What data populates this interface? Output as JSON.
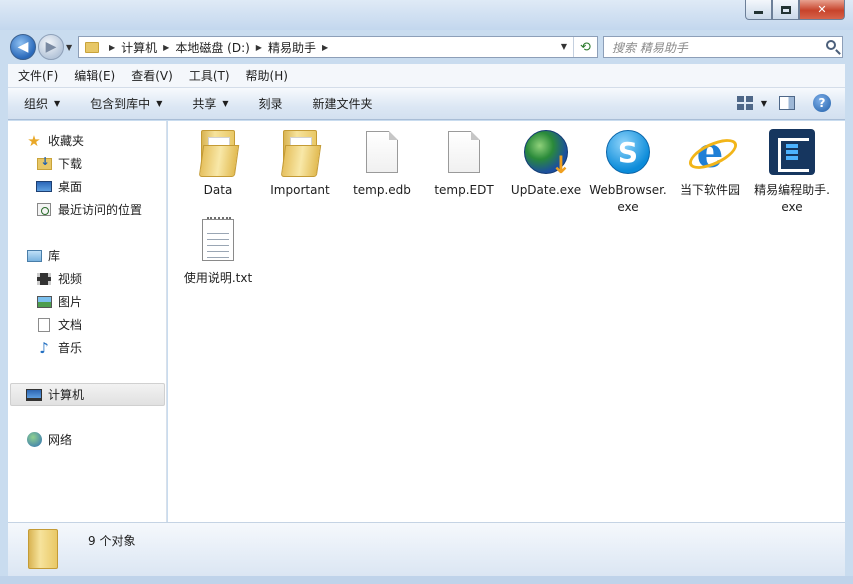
{
  "window": {
    "minimize_glyph": "",
    "close_glyph": "✕"
  },
  "address": {
    "crumbs": [
      "计算机",
      "本地磁盘 (D:)",
      "精易助手"
    ],
    "refresh_glyph": "⟲"
  },
  "search": {
    "placeholder": "搜索 精易助手"
  },
  "menu": {
    "items": [
      "文件(F)",
      "编辑(E)",
      "查看(V)",
      "工具(T)",
      "帮助(H)"
    ]
  },
  "commands": {
    "items": [
      {
        "label": "组织",
        "has_arrow": true
      },
      {
        "label": "包含到库中",
        "has_arrow": true
      },
      {
        "label": "共享",
        "has_arrow": true
      },
      {
        "label": "刻录",
        "has_arrow": false
      },
      {
        "label": "新建文件夹",
        "has_arrow": false
      }
    ],
    "help_glyph": "?"
  },
  "nav": {
    "favorites": "收藏夹",
    "downloads": "下载",
    "desktop": "桌面",
    "recent": "最近访问的位置",
    "libraries": "库",
    "videos": "视频",
    "pictures": "图片",
    "documents": "文档",
    "music": "音乐",
    "computer": "计算机",
    "network": "网络"
  },
  "files": [
    {
      "name": "Data",
      "icon": "folder-icon"
    },
    {
      "name": "Important",
      "icon": "folder-icon"
    },
    {
      "name": "temp.edb",
      "icon": "file-icon"
    },
    {
      "name": "temp.EDT",
      "icon": "file-icon"
    },
    {
      "name": "UpDate.exe",
      "icon": "update-globe-icon"
    },
    {
      "name": "WebBrowser.exe",
      "icon": "skype-icon"
    },
    {
      "name": "当下软件园",
      "icon": "ie-icon"
    },
    {
      "name": "精易编程助手.exe",
      "icon": "e-app-icon"
    },
    {
      "name": "使用说明.txt",
      "icon": "text-file-icon"
    }
  ],
  "status": {
    "count": "9 个对象"
  }
}
